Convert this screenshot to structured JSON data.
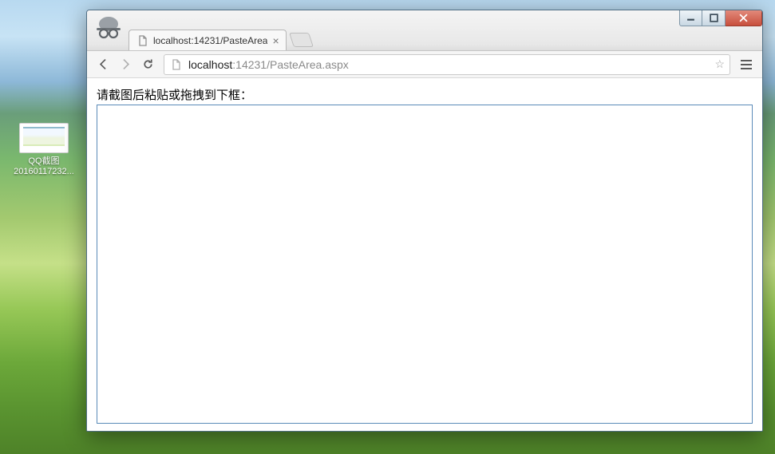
{
  "desktop_icon": {
    "line1": "QQ截图",
    "line2": "20160117232..."
  },
  "tab": {
    "title": "localhost:14231/PasteArea"
  },
  "omnibox": {
    "host": "localhost",
    "path": ":14231/PasteArea.aspx"
  },
  "page": {
    "prompt": "请截图后粘贴或拖拽到下框：",
    "textarea_value": ""
  }
}
